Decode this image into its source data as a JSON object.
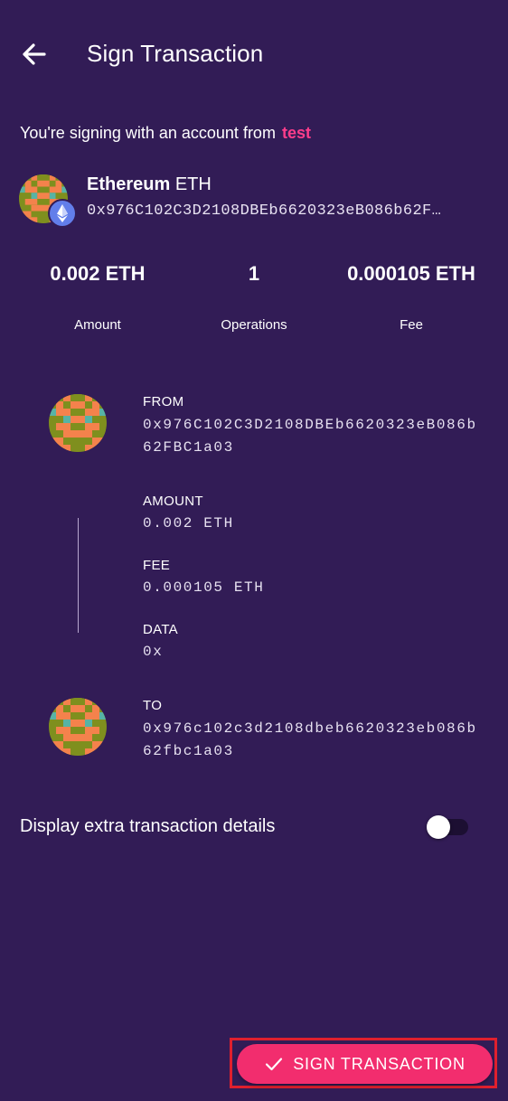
{
  "header": {
    "title": "Sign Transaction",
    "back_icon": "arrow-left-icon"
  },
  "signing": {
    "prefix": "You're signing with an account from",
    "account": "test"
  },
  "account": {
    "coin_name": "Ethereum",
    "ticker": "ETH",
    "address": "0x976C102C3D2108DBEb6620323eB086b62F…",
    "badge_icon": "ethereum-icon"
  },
  "stats": [
    {
      "value": "0.002 ETH",
      "label": "Amount"
    },
    {
      "value": "1",
      "label": "Operations"
    },
    {
      "value": "0.000105 ETH",
      "label": "Fee"
    }
  ],
  "flow": {
    "from": {
      "label": "FROM",
      "line1": "0x976C102C3D2108DBEb6620323eB086b",
      "line2": "62FBC1a03"
    },
    "amount": {
      "label": "AMOUNT",
      "value": "0.002 ETH"
    },
    "fee": {
      "label": "FEE",
      "value": "0.000105 ETH"
    },
    "data": {
      "label": "DATA",
      "value": "0x"
    },
    "to": {
      "label": "TO",
      "line1": "0x976c102c3d2108dbeb6620323eb086b",
      "line2": "62fbc1a03"
    }
  },
  "extra_details": {
    "label": "Display extra transaction details",
    "enabled": false
  },
  "sign_button": {
    "label": "SIGN TRANSACTION",
    "icon": "checkmark-icon"
  },
  "colors": {
    "background": "#321c56",
    "accent": "#f22d6e",
    "account_highlight": "#ff3d8b",
    "eth_badge": "#627eea"
  }
}
